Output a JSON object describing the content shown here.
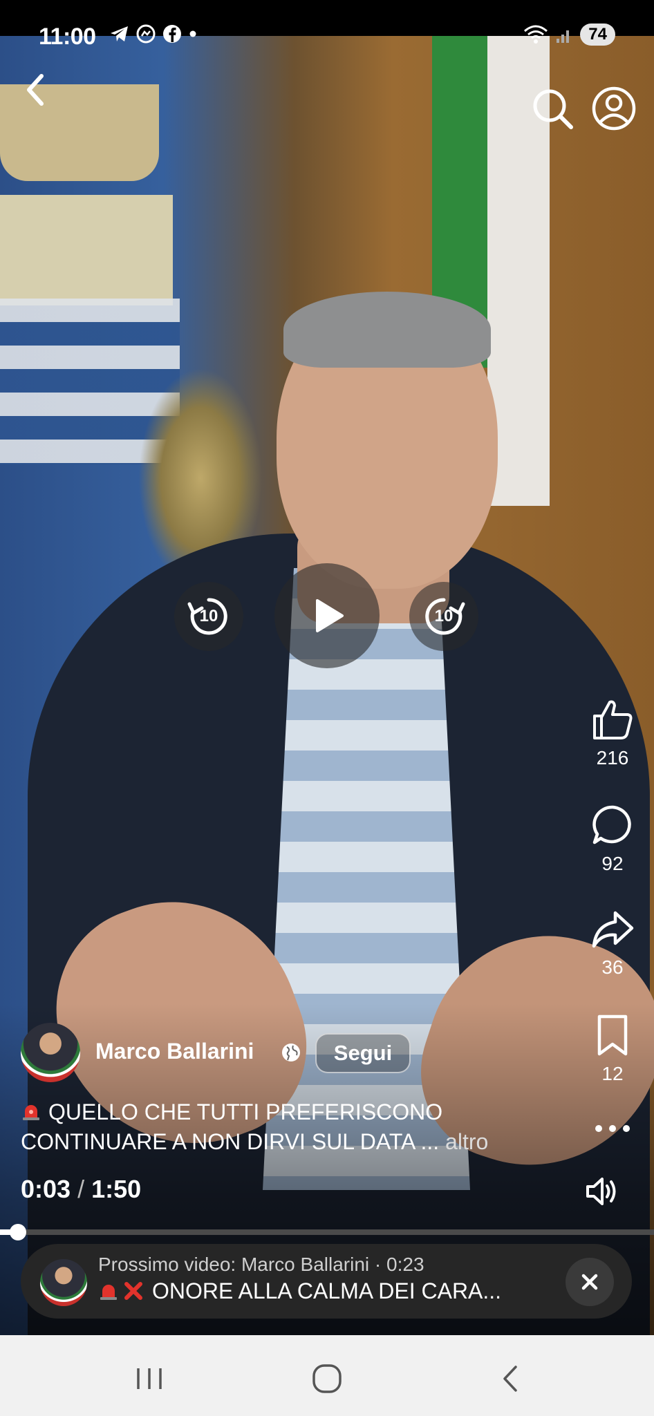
{
  "status_bar": {
    "time": "11:00",
    "battery": "74",
    "signal_label": "5",
    "left_icons": [
      "telegram-icon",
      "messenger-icon",
      "facebook-icon",
      "dot-icon"
    ],
    "right_icons": [
      "wifi-icon",
      "signal-icon",
      "battery-icon"
    ]
  },
  "video": {
    "rewind_label": "10",
    "forward_label": "10",
    "state": "paused"
  },
  "actions": {
    "likes": "216",
    "comments": "92",
    "shares": "36",
    "saves": "12"
  },
  "author": {
    "name": "Marco Ballarini",
    "follow_label": "Segui"
  },
  "caption": {
    "text": "QUELLO CHE TUTTI PREFERISCONO CONTINUARE A NON DIRVI SUL DATA ...",
    "more_label": "altro"
  },
  "playback": {
    "current": "0:03",
    "separator": "/",
    "duration": "1:50",
    "progress_fraction": 0.027
  },
  "next_video": {
    "meta": "Prossimo video: Marco Ballarini · 0:23",
    "title": "ONORE ALLA CALMA DEI CARA..."
  },
  "colors": {
    "accent": "#ffffff",
    "next_bar_bg": "#262626",
    "nav_bg": "#f1f1f1"
  }
}
